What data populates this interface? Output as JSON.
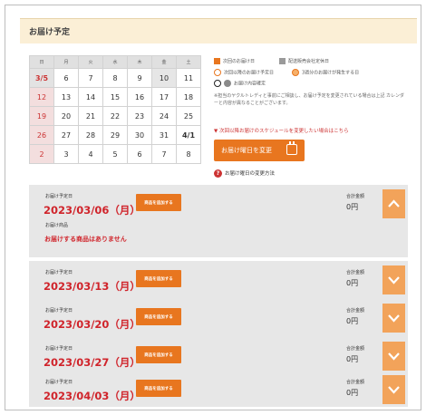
{
  "header": {
    "title": "お届け予定"
  },
  "calendar": {
    "weekdays": [
      "日",
      "月",
      "火",
      "水",
      "木",
      "金",
      "土"
    ],
    "weeks": [
      [
        "3/5",
        "6",
        "7",
        "8",
        "9",
        "10",
        "11"
      ],
      [
        "12",
        "13",
        "14",
        "15",
        "16",
        "17",
        "18"
      ],
      [
        "19",
        "20",
        "21",
        "22",
        "23",
        "24",
        "25"
      ],
      [
        "26",
        "27",
        "28",
        "29",
        "30",
        "31",
        "4/1"
      ],
      [
        "2",
        "3",
        "4",
        "5",
        "6",
        "7",
        "8"
      ]
    ]
  },
  "legend": {
    "next_delivery": "次回のお届け日",
    "partner_holiday": "配送販売会社定休日",
    "after_next": "次回以降のお届け予定日",
    "extra_fee": "3週分のお届けが発生する日",
    "confirmed": "お届け内容確定",
    "note": "※担当のヤクルトレディと事前にご相談し、お届け予定を変更されている場合は上記 カレンダーと内容が異なることがございます。"
  },
  "actions": {
    "change_schedule_link": "次回以降お届けのスケジュールを変更したい場合はこちら",
    "change_day_button": "お届け曜日を変更",
    "help_link": "お届け曜日の変更方法"
  },
  "deliveries": [
    {
      "label": "お届け予定日",
      "date": "2023/03/06（月）",
      "add_button": "商品を追加する",
      "total_label": "合計金額",
      "total": "0円",
      "expanded": true,
      "items_label": "お届け商品",
      "items_empty": "お届けする商品はありません"
    },
    {
      "label": "お届け予定日",
      "date": "2023/03/13（月）",
      "add_button": "商品を追加する",
      "total_label": "合計金額",
      "total": "0円",
      "expanded": false
    },
    {
      "label": "お届け予定日",
      "date": "2023/03/20（月）",
      "add_button": "商品を追加する",
      "total_label": "合計金額",
      "total": "0円",
      "expanded": false
    },
    {
      "label": "お届け予定日",
      "date": "2023/03/27（月）",
      "add_button": "商品を追加する",
      "total_label": "合計金額",
      "total": "0円",
      "expanded": false
    },
    {
      "label": "お届け予定日",
      "date": "2023/04/03（月）",
      "add_button": "商品を追加する",
      "total_label": "合計金額",
      "total": "0円",
      "expanded": false
    }
  ],
  "colors": {
    "accent": "#e8761f",
    "date_red": "#d0242b",
    "header_bg": "#fbefd6",
    "card_bg": "#e7e7e7"
  }
}
